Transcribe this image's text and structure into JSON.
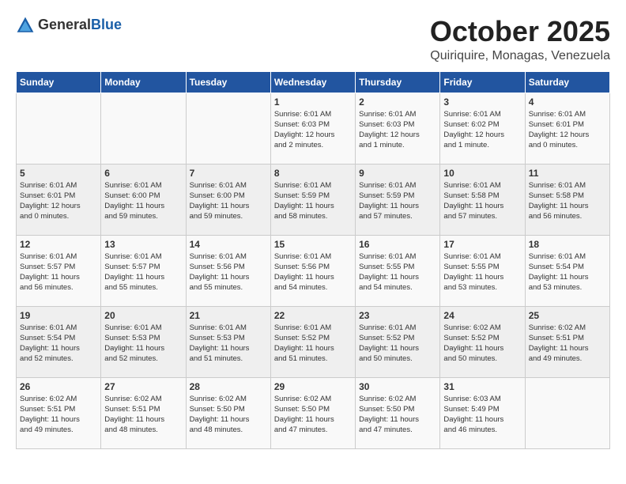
{
  "header": {
    "logo_general": "General",
    "logo_blue": "Blue",
    "month_title": "October 2025",
    "location": "Quiriquire, Monagas, Venezuela"
  },
  "calendar": {
    "days_of_week": [
      "Sunday",
      "Monday",
      "Tuesday",
      "Wednesday",
      "Thursday",
      "Friday",
      "Saturday"
    ],
    "weeks": [
      [
        {
          "day": "",
          "info": ""
        },
        {
          "day": "",
          "info": ""
        },
        {
          "day": "",
          "info": ""
        },
        {
          "day": "1",
          "info": "Sunrise: 6:01 AM\nSunset: 6:03 PM\nDaylight: 12 hours\nand 2 minutes."
        },
        {
          "day": "2",
          "info": "Sunrise: 6:01 AM\nSunset: 6:03 PM\nDaylight: 12 hours\nand 1 minute."
        },
        {
          "day": "3",
          "info": "Sunrise: 6:01 AM\nSunset: 6:02 PM\nDaylight: 12 hours\nand 1 minute."
        },
        {
          "day": "4",
          "info": "Sunrise: 6:01 AM\nSunset: 6:01 PM\nDaylight: 12 hours\nand 0 minutes."
        }
      ],
      [
        {
          "day": "5",
          "info": "Sunrise: 6:01 AM\nSunset: 6:01 PM\nDaylight: 12 hours\nand 0 minutes."
        },
        {
          "day": "6",
          "info": "Sunrise: 6:01 AM\nSunset: 6:00 PM\nDaylight: 11 hours\nand 59 minutes."
        },
        {
          "day": "7",
          "info": "Sunrise: 6:01 AM\nSunset: 6:00 PM\nDaylight: 11 hours\nand 59 minutes."
        },
        {
          "day": "8",
          "info": "Sunrise: 6:01 AM\nSunset: 5:59 PM\nDaylight: 11 hours\nand 58 minutes."
        },
        {
          "day": "9",
          "info": "Sunrise: 6:01 AM\nSunset: 5:59 PM\nDaylight: 11 hours\nand 57 minutes."
        },
        {
          "day": "10",
          "info": "Sunrise: 6:01 AM\nSunset: 5:58 PM\nDaylight: 11 hours\nand 57 minutes."
        },
        {
          "day": "11",
          "info": "Sunrise: 6:01 AM\nSunset: 5:58 PM\nDaylight: 11 hours\nand 56 minutes."
        }
      ],
      [
        {
          "day": "12",
          "info": "Sunrise: 6:01 AM\nSunset: 5:57 PM\nDaylight: 11 hours\nand 56 minutes."
        },
        {
          "day": "13",
          "info": "Sunrise: 6:01 AM\nSunset: 5:57 PM\nDaylight: 11 hours\nand 55 minutes."
        },
        {
          "day": "14",
          "info": "Sunrise: 6:01 AM\nSunset: 5:56 PM\nDaylight: 11 hours\nand 55 minutes."
        },
        {
          "day": "15",
          "info": "Sunrise: 6:01 AM\nSunset: 5:56 PM\nDaylight: 11 hours\nand 54 minutes."
        },
        {
          "day": "16",
          "info": "Sunrise: 6:01 AM\nSunset: 5:55 PM\nDaylight: 11 hours\nand 54 minutes."
        },
        {
          "day": "17",
          "info": "Sunrise: 6:01 AM\nSunset: 5:55 PM\nDaylight: 11 hours\nand 53 minutes."
        },
        {
          "day": "18",
          "info": "Sunrise: 6:01 AM\nSunset: 5:54 PM\nDaylight: 11 hours\nand 53 minutes."
        }
      ],
      [
        {
          "day": "19",
          "info": "Sunrise: 6:01 AM\nSunset: 5:54 PM\nDaylight: 11 hours\nand 52 minutes."
        },
        {
          "day": "20",
          "info": "Sunrise: 6:01 AM\nSunset: 5:53 PM\nDaylight: 11 hours\nand 52 minutes."
        },
        {
          "day": "21",
          "info": "Sunrise: 6:01 AM\nSunset: 5:53 PM\nDaylight: 11 hours\nand 51 minutes."
        },
        {
          "day": "22",
          "info": "Sunrise: 6:01 AM\nSunset: 5:52 PM\nDaylight: 11 hours\nand 51 minutes."
        },
        {
          "day": "23",
          "info": "Sunrise: 6:01 AM\nSunset: 5:52 PM\nDaylight: 11 hours\nand 50 minutes."
        },
        {
          "day": "24",
          "info": "Sunrise: 6:02 AM\nSunset: 5:52 PM\nDaylight: 11 hours\nand 50 minutes."
        },
        {
          "day": "25",
          "info": "Sunrise: 6:02 AM\nSunset: 5:51 PM\nDaylight: 11 hours\nand 49 minutes."
        }
      ],
      [
        {
          "day": "26",
          "info": "Sunrise: 6:02 AM\nSunset: 5:51 PM\nDaylight: 11 hours\nand 49 minutes."
        },
        {
          "day": "27",
          "info": "Sunrise: 6:02 AM\nSunset: 5:51 PM\nDaylight: 11 hours\nand 48 minutes."
        },
        {
          "day": "28",
          "info": "Sunrise: 6:02 AM\nSunset: 5:50 PM\nDaylight: 11 hours\nand 48 minutes."
        },
        {
          "day": "29",
          "info": "Sunrise: 6:02 AM\nSunset: 5:50 PM\nDaylight: 11 hours\nand 47 minutes."
        },
        {
          "day": "30",
          "info": "Sunrise: 6:02 AM\nSunset: 5:50 PM\nDaylight: 11 hours\nand 47 minutes."
        },
        {
          "day": "31",
          "info": "Sunrise: 6:03 AM\nSunset: 5:49 PM\nDaylight: 11 hours\nand 46 minutes."
        },
        {
          "day": "",
          "info": ""
        }
      ]
    ]
  }
}
